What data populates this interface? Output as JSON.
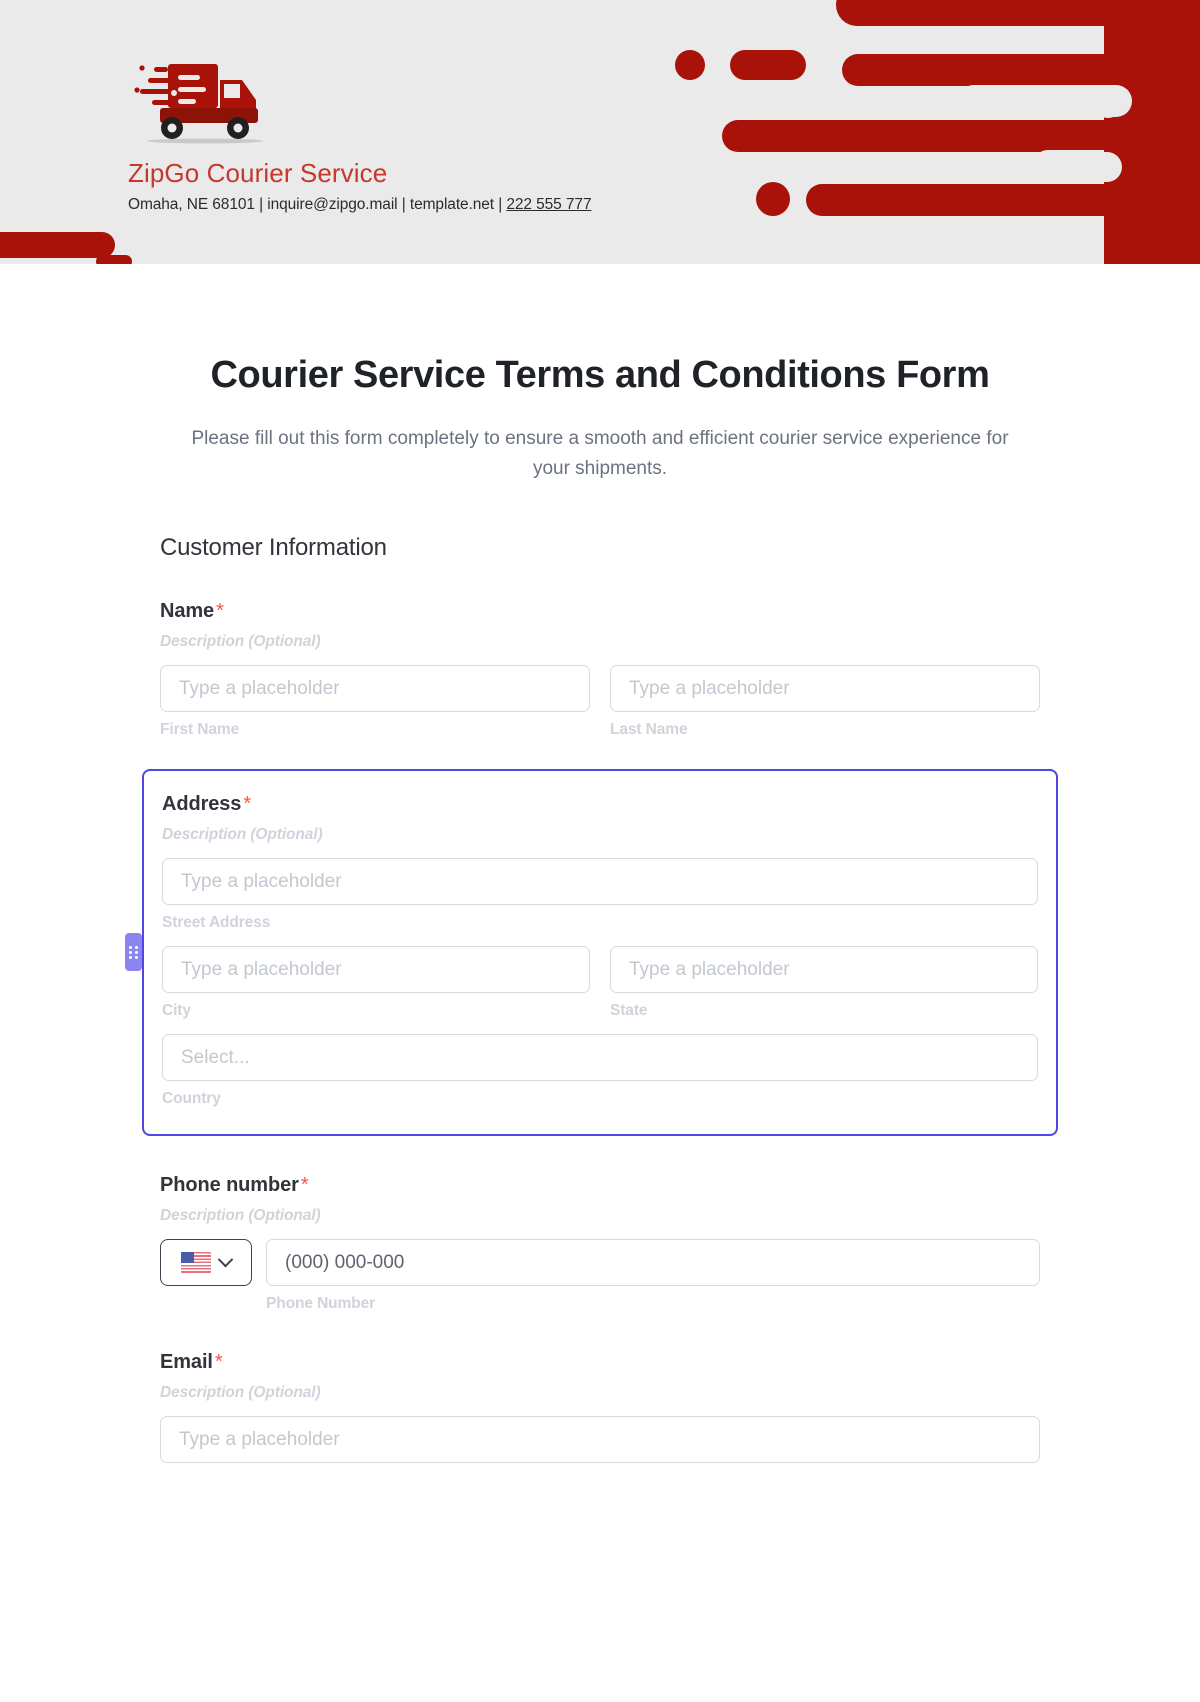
{
  "letterhead": {
    "logo_icon": "delivery-truck-icon",
    "brand_name": "ZipGo Courier Service",
    "contact_address": "Omaha, NE 68101",
    "contact_email": "inquire@zipgo.mail",
    "contact_website": "template.net",
    "contact_phone": "222 555 777",
    "separator": "|",
    "background_color": "#eaeaea",
    "accent_color": "#a81208",
    "brand_text_color": "#c5392c"
  },
  "form": {
    "title": "Courier Service Terms and Conditions Form",
    "subtitle": "Please fill out this form completely to ensure a smooth and efficient courier service experience for your shipments.",
    "section_title": "Customer Information",
    "required_marker": "*",
    "description_placeholder": "Description (Optional)",
    "focus_color": "#4f46e5",
    "fields": [
      {
        "label": "Name",
        "required": true,
        "description": "Description (Optional)",
        "inputs": [
          {
            "placeholder": "Type a placeholder",
            "sublabel": "First Name"
          },
          {
            "placeholder": "Type a placeholder",
            "sublabel": "Last Name"
          }
        ]
      },
      {
        "label": "Address",
        "required": true,
        "focused": true,
        "description": "Description (Optional)",
        "street": {
          "placeholder": "Type a placeholder",
          "sublabel": "Street Address"
        },
        "city": {
          "placeholder": "Type a placeholder",
          "sublabel": "City"
        },
        "state": {
          "placeholder": "Type a placeholder",
          "sublabel": "State"
        },
        "country": {
          "placeholder": "Select...",
          "sublabel": "Country"
        }
      },
      {
        "label": "Phone number",
        "required": true,
        "description": "Description (Optional)",
        "country_flag": "us-flag-icon",
        "dropdown_icon": "chevron-down-icon",
        "placeholder": "(000) 000-000",
        "sublabel": "Phone Number"
      },
      {
        "label": "Email",
        "required": true,
        "description": "Description (Optional)",
        "placeholder": "Type a placeholder"
      }
    ]
  }
}
